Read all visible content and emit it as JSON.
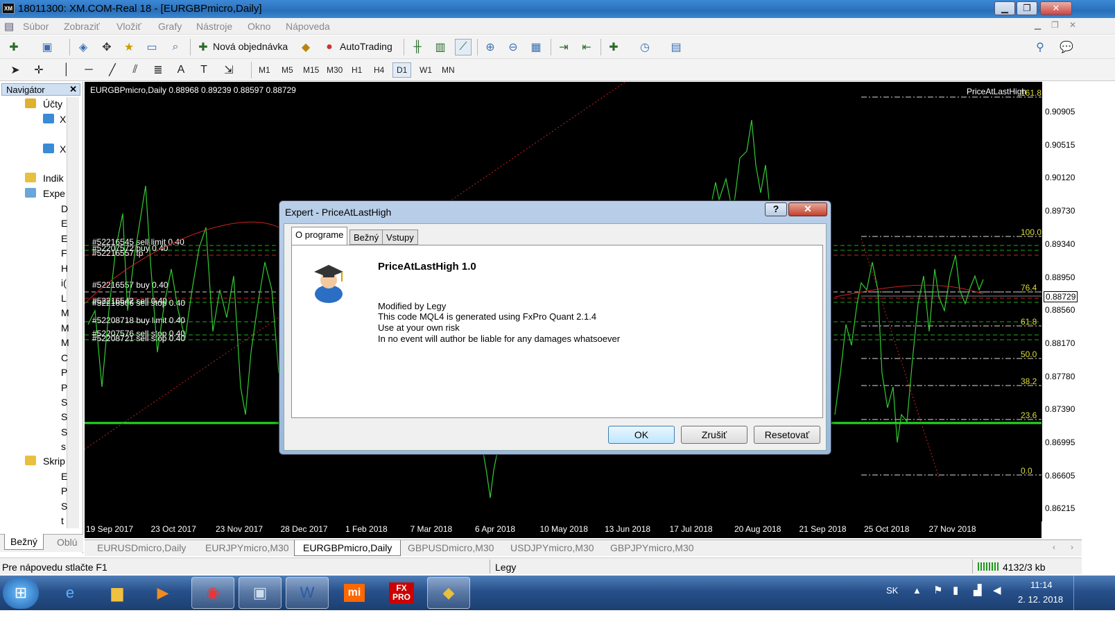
{
  "window": {
    "title": "18011300: XM.COM-Real 18 - [EURGBPmicro,Daily]",
    "logo": "XM"
  },
  "menu": [
    "Súbor",
    "Zobraziť",
    "Vložiť",
    "Grafy",
    "Nástroje",
    "Okno",
    "Nápoveda"
  ],
  "toolbar": {
    "new_order": "Nová objednávka",
    "autotrading": "AutoTrading"
  },
  "timeframes": [
    "M1",
    "M5",
    "M15",
    "M30",
    "H1",
    "H4",
    "D1",
    "W1",
    "MN"
  ],
  "navigator": {
    "title": "Navigátor",
    "items": {
      "accounts": "Účty",
      "acc1": "X",
      "acc2": "X",
      "indicators": "Indik",
      "experts": "Expe",
      "ex_d": "D",
      "ex_e1": "E",
      "ex_e2": "E",
      "ex_f": "F",
      "ex_h": "H",
      "ex_i": "i(",
      "ex_l": "L",
      "ex_m1": "M",
      "ex_m2": "M",
      "ex_m3": "M",
      "ex_o": "C",
      "ex_p1": "P",
      "ex_p2": "P",
      "ex_s1": "S",
      "ex_s2": "S",
      "ex_s3": "S",
      "ex_s4": "s",
      "scripts": "Skrip",
      "sc_e": "E",
      "sc_p": "P",
      "sc_s": "S",
      "sc_t": "t"
    },
    "tabs": [
      "Bežný",
      "Oblú"
    ]
  },
  "chart": {
    "header": "EURGBPmicro,Daily  0.88968 0.89239 0.88597 0.88729",
    "indicator_label": "PriceAtLastHigh",
    "price_labels": [
      "0.90905",
      "0.90515",
      "0.90120",
      "0.89730",
      "0.89340",
      "0.88950",
      "0.88560",
      "0.88170",
      "0.87780",
      "0.87390",
      "0.86995",
      "0.86605",
      "0.86215"
    ],
    "current_price": "0.88729",
    "time_labels": [
      "19 Sep 2017",
      "23 Oct 2017",
      "23 Nov 2017",
      "28 Dec 2017",
      "1 Feb 2018",
      "7 Mar 2018",
      "6 Apr 2018",
      "10 May 2018",
      "13 Jun 2018",
      "17 Jul 2018",
      "20 Aug 2018",
      "21 Sep 2018",
      "25 Oct 2018",
      "27 Nov 2018"
    ],
    "order_labels": [
      "#52216545 sell limit 0.40",
      "#52207572 buy 0.40",
      "#52216557 tp",
      "#52216557 buy 0.40",
      "#52216542 sell 0.40",
      "#52216566 sell stop 0.40",
      "#52208718 buy limit 0.40",
      "#52207576 sell stop 0.40",
      "#52208721 sell stop 0.40"
    ],
    "fib_levels": [
      "161.8",
      "100.0",
      "76.4",
      "61.8",
      "50.0",
      "38.2",
      "23.6",
      "0.0"
    ]
  },
  "chart_tabs": [
    "EURUSDmicro,Daily",
    "EURJPYmicro,M30",
    "EURGBPmicro,Daily",
    "GBPUSDmicro,M30",
    "USDJPYmicro,M30",
    "GBPJPYmicro,M30"
  ],
  "status": {
    "help": "Pre nápovedu stlačte F1",
    "profile": "Legy",
    "traffic": "4132/3 kb"
  },
  "dialog": {
    "title": "Expert - PriceAtLastHigh",
    "help_btn": "?",
    "close_btn": "✕",
    "tabs": [
      "O programe",
      "Bežný",
      "Vstupy"
    ],
    "name": "PriceAtLastHigh 1.0",
    "lines": [
      "Modified by Legy",
      "This code MQL4 is generated using FxPro Quant 2.1.4",
      "Use at your own risk",
      "In no event will author be liable for any damages whatsoever"
    ],
    "buttons": {
      "ok": "OK",
      "cancel": "Zrušiť",
      "reset": "Resetovať"
    }
  },
  "taskbar": {
    "lang": "SK",
    "time": "11:14",
    "date": "2. 12. 2018",
    "mi": "mi",
    "fxpro": "FX PRO"
  }
}
